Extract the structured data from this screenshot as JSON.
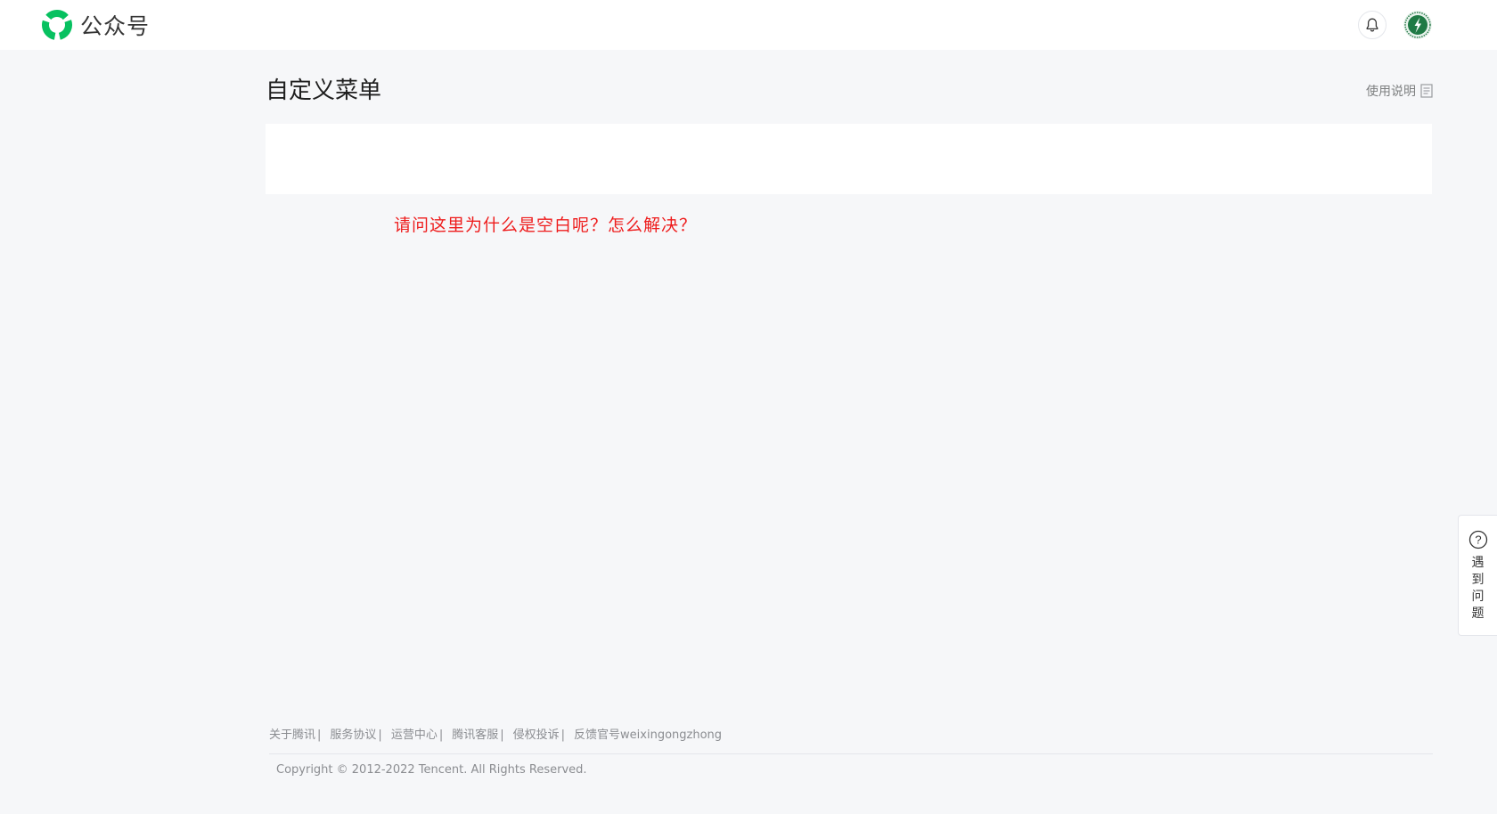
{
  "header": {
    "brand_name": "公众号",
    "logo_icon": "wechat-official-account-logo",
    "brand_color": "#07c160",
    "bell_icon": "bell-icon",
    "avatar_icon": "account-avatar"
  },
  "page": {
    "title": "自定义菜单",
    "help_link_label": "使用说明",
    "help_link_icon": "document-icon"
  },
  "annotation": {
    "text": "请问这里为什么是空白呢？怎么解决？",
    "color": "#ee1c1c"
  },
  "footer": {
    "links": [
      {
        "label": "关于腾讯",
        "separator": "|"
      },
      {
        "label": "服务协议",
        "separator": "|"
      },
      {
        "label": "运营中心",
        "separator": "|"
      },
      {
        "label": "腾讯客服",
        "separator": "|"
      },
      {
        "label": "侵权投诉",
        "separator": "|"
      },
      {
        "label": "反馈官号weixingongzhong",
        "separator": ""
      }
    ],
    "copyright": "Copyright © 2012-2022 Tencent. All Rights Reserved."
  },
  "side_help": {
    "icon": "question-circle-icon",
    "label": "遇到问题"
  }
}
